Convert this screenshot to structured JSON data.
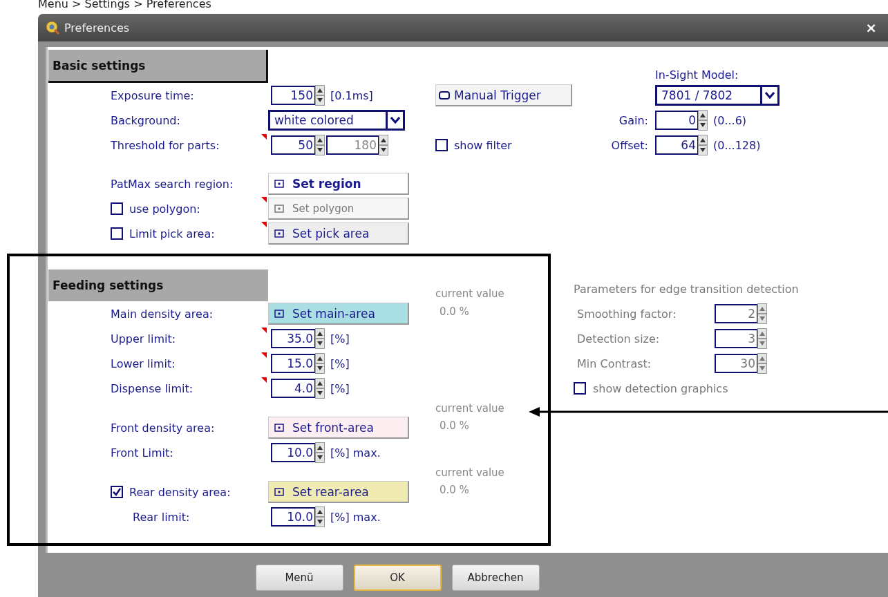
{
  "caption": "Menu > Settings > Preferences",
  "window": {
    "title": "Preferences",
    "close": "×"
  },
  "basic": {
    "header": {
      "label": "Basic settings",
      "selected": true
    },
    "rows": [
      {
        "kind": "spin",
        "label": "Exposure time:",
        "flagged": false,
        "fields": [
          {
            "value": "150",
            "disabled": false
          }
        ],
        "unit": "[0.1ms]"
      },
      {
        "kind": "select",
        "label": "Background:",
        "value": "white colored"
      },
      {
        "kind": "spin",
        "label": "Threshold for parts:",
        "flagged": true,
        "fields": [
          {
            "value": "50",
            "disabled": false
          },
          {
            "value": "180",
            "disabled": true
          }
        ]
      },
      {
        "kind": "button",
        "label": "PatMax search region:",
        "flagged": false,
        "button": {
          "label": "Set region",
          "color": "#ffffff",
          "disabled": false,
          "bold": true
        }
      },
      {
        "kind": "check",
        "label": "use polygon:",
        "checked": false,
        "flagged": true,
        "button": {
          "label": "Set polygon",
          "color": "#f7f7f7",
          "disabled": true,
          "bold": false
        }
      },
      {
        "kind": "check",
        "label": "Limit pick area:",
        "checked": false,
        "flagged": true,
        "button": {
          "label": "Set pick area",
          "color": "#eeeeee",
          "disabled": false,
          "bold": false
        }
      }
    ],
    "trigger": {
      "label": "Manual Trigger"
    },
    "show_filter": {
      "label": "show filter",
      "checked": false
    },
    "model": {
      "label": "In-Sight Model:",
      "value": "7801 / 7802"
    },
    "camera": [
      {
        "label": "Gain:",
        "value": "0",
        "range": "(0...6)"
      },
      {
        "label": "Offset:",
        "value": "64",
        "range": "(0...128)"
      }
    ]
  },
  "feeding": {
    "header": {
      "label": "Feeding settings",
      "selected": false
    },
    "areas": [
      {
        "kind": "plain",
        "label": "Main density area:",
        "button": {
          "label": "Set main-area",
          "color": "#a9dee2"
        },
        "current_label": "current value",
        "current_value": "0.0 %",
        "limits": [
          {
            "label": "Upper limit:",
            "value": "35.0",
            "unit": "[%]",
            "flagged": true
          },
          {
            "label": "Lower limit:",
            "value": "15.0",
            "unit": "[%]",
            "flagged": true
          },
          {
            "label": "Dispense limit:",
            "value": "4.0",
            "unit": "[%]",
            "flagged": true
          }
        ]
      },
      {
        "kind": "plain",
        "label": "Front density area:",
        "button": {
          "label": "Set front-area",
          "color": "#fdeef1"
        },
        "current_label": "current value",
        "current_value": "0.0 %",
        "limits": [
          {
            "label": "Front Limit:",
            "value": "10.0",
            "unit": "[%] max.",
            "flagged": false
          }
        ]
      },
      {
        "kind": "check",
        "checked": true,
        "label": "Rear density area:",
        "button": {
          "label": "Set rear-area",
          "color": "#f0ebb0"
        },
        "current_label": "current value",
        "current_value": "0.0 %",
        "limits": [
          {
            "label": "Rear limit:",
            "value": "10.0",
            "unit": "[%] max.",
            "flagged": false
          }
        ]
      }
    ]
  },
  "edge": {
    "title": "Parameters for edge transition detection",
    "disabled": true,
    "params": [
      {
        "label": "Smoothing factor:",
        "value": "2"
      },
      {
        "label": "Detection size:",
        "value": "3"
      },
      {
        "label": "Min Contrast:",
        "value": "30"
      }
    ],
    "graphics": {
      "label": "show detection graphics",
      "checked": false
    }
  },
  "buttons": [
    {
      "label": "Menü",
      "default": false
    },
    {
      "label": "OK",
      "default": true
    },
    {
      "label": "Abbrechen",
      "default": false
    }
  ]
}
